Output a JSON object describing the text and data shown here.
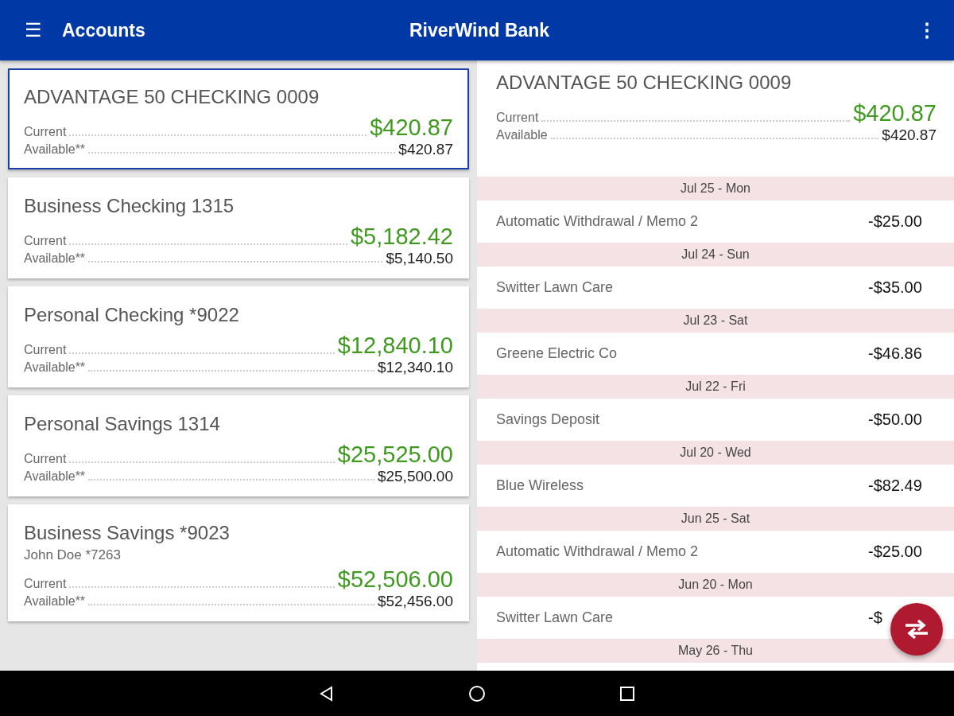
{
  "app_bar": {
    "menu_icon": "☰",
    "title": "Accounts",
    "bank_name": "RiverWind Bank",
    "overflow_icon": "⋮"
  },
  "accounts": [
    {
      "name": "ADVANTAGE 50 CHECKING 0009",
      "current_label": "Current",
      "current": "$420.87",
      "available_label": "Available**",
      "available": "$420.87",
      "selected": true
    },
    {
      "name": "Business Checking 1315",
      "current_label": "Current",
      "current": "$5,182.42",
      "available_label": "Available**",
      "available": "$5,140.50",
      "selected": false
    },
    {
      "name": "Personal Checking *9022",
      "current_label": "Current",
      "current": "$12,840.10",
      "available_label": "Available**",
      "available": "$12,340.10",
      "selected": false
    },
    {
      "name": "Personal Savings 1314",
      "current_label": "Current",
      "current": "$25,525.00",
      "available_label": "Available**",
      "available": "$25,500.00",
      "selected": false
    },
    {
      "name": "Business Savings *9023",
      "owner": "John Doe *7263",
      "current_label": "Current",
      "current": "$52,506.00",
      "available_label": "Available**",
      "available": "$52,456.00",
      "selected": false
    }
  ],
  "detail": {
    "name": "ADVANTAGE 50 CHECKING 0009",
    "current_label": "Current",
    "current": "$420.87",
    "available_label": "Available",
    "available": "$420.87",
    "transactions": [
      {
        "date": "Jul 25 - Mon",
        "description": "Automatic Withdrawal / Memo 2",
        "amount": "-$25.00"
      },
      {
        "date": "Jul 24 - Sun",
        "description": "Switter Lawn Care",
        "amount": "-$35.00"
      },
      {
        "date": "Jul 23 - Sat",
        "description": "Greene Electric Co",
        "amount": "-$46.86"
      },
      {
        "date": "Jul 22 - Fri",
        "description": "Savings Deposit",
        "amount": "-$50.00"
      },
      {
        "date": "Jul 20 - Wed",
        "description": "Blue Wireless",
        "amount": "-$82.49"
      },
      {
        "date": "Jun 25 - Sat",
        "description": "Automatic Withdrawal / Memo 2",
        "amount": "-$25.00"
      },
      {
        "date": "Jun 20 - Mon",
        "description": "Switter Lawn Care",
        "amount": "-$"
      },
      {
        "date": "May 26 - Thu"
      }
    ]
  }
}
